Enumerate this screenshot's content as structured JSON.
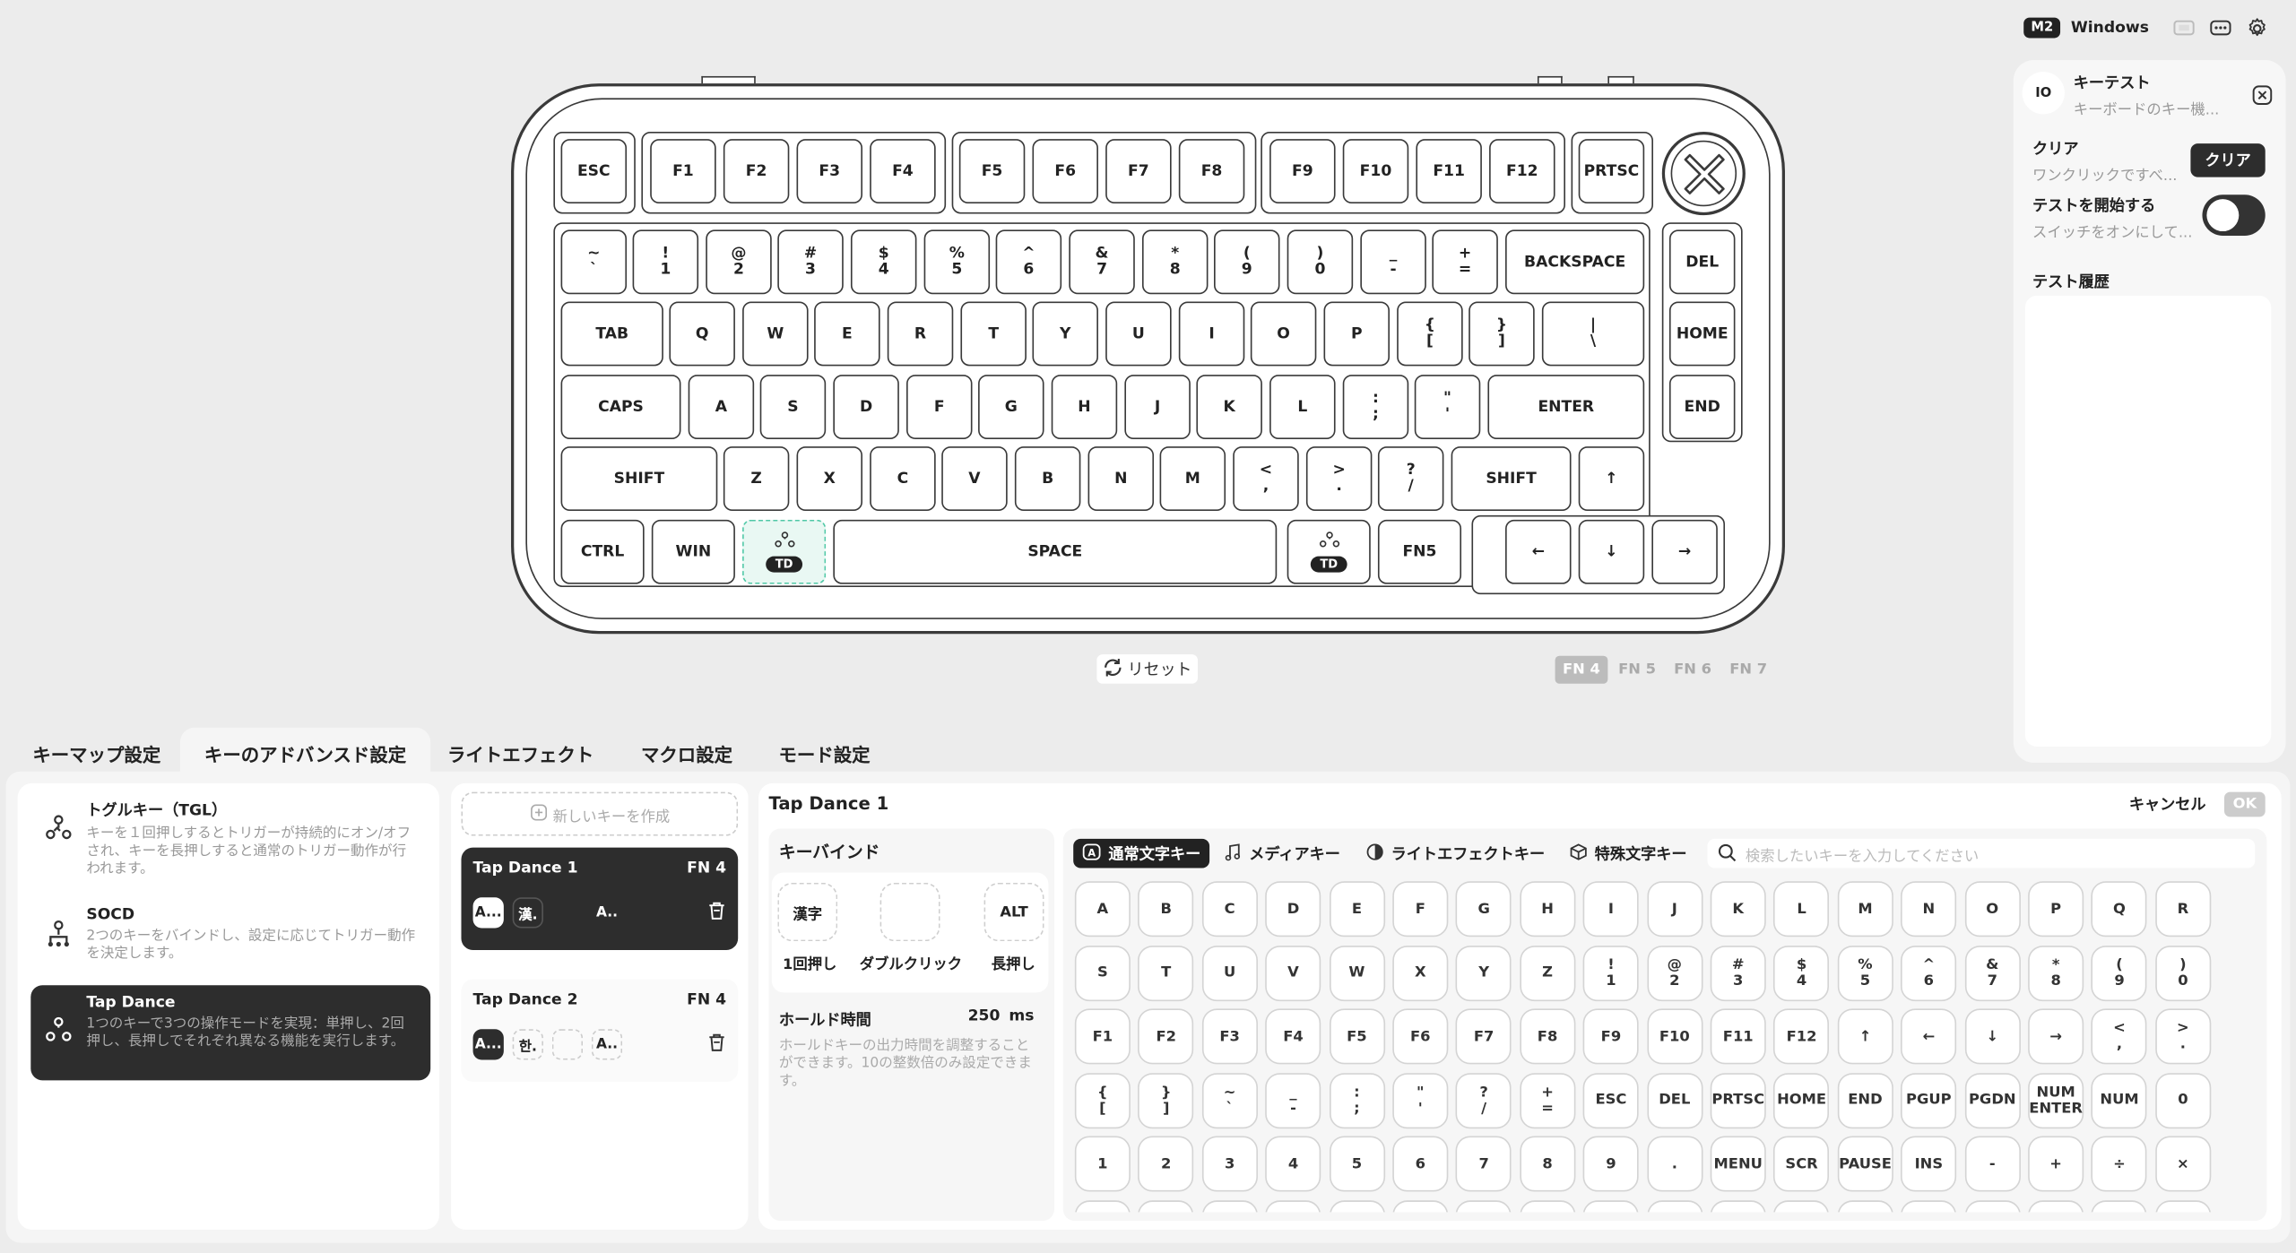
{
  "topbar": {
    "mode_badge": "M2",
    "os": "Windows"
  },
  "keyboard": {
    "rows": [
      [
        {
          "k": "esc",
          "l": [
            "ESC"
          ]
        },
        {
          "k": "f1",
          "l": [
            "F1"
          ]
        },
        {
          "k": "f2",
          "l": [
            "F2"
          ]
        },
        {
          "k": "f3",
          "l": [
            "F3"
          ]
        },
        {
          "k": "f4",
          "l": [
            "F4"
          ]
        },
        {
          "k": "f5",
          "l": [
            "F5"
          ]
        },
        {
          "k": "f6",
          "l": [
            "F6"
          ]
        },
        {
          "k": "f7",
          "l": [
            "F7"
          ]
        },
        {
          "k": "f8",
          "l": [
            "F8"
          ]
        },
        {
          "k": "f9",
          "l": [
            "F9"
          ]
        },
        {
          "k": "f10",
          "l": [
            "F10"
          ]
        },
        {
          "k": "f11",
          "l": [
            "F11"
          ]
        },
        {
          "k": "f12",
          "l": [
            "F12"
          ]
        },
        {
          "k": "prtsc",
          "l": [
            "PRTSC"
          ]
        }
      ],
      [
        {
          "k": "grave",
          "l": [
            "~",
            "`"
          ]
        },
        {
          "k": "1",
          "l": [
            "!",
            "1"
          ]
        },
        {
          "k": "2",
          "l": [
            "@",
            "2"
          ]
        },
        {
          "k": "3",
          "l": [
            "#",
            "3"
          ]
        },
        {
          "k": "4",
          "l": [
            "$",
            "4"
          ]
        },
        {
          "k": "5",
          "l": [
            "%",
            "5"
          ]
        },
        {
          "k": "6",
          "l": [
            "^",
            "6"
          ]
        },
        {
          "k": "7",
          "l": [
            "&",
            "7"
          ]
        },
        {
          "k": "8",
          "l": [
            "*",
            "8"
          ]
        },
        {
          "k": "9",
          "l": [
            "(",
            "9"
          ]
        },
        {
          "k": "0",
          "l": [
            ")",
            "0"
          ]
        },
        {
          "k": "minus",
          "l": [
            "_",
            "-"
          ]
        },
        {
          "k": "equal",
          "l": [
            "+",
            "="
          ]
        },
        {
          "k": "backspace",
          "l": [
            "BACKSPACE"
          ]
        },
        {
          "k": "del",
          "l": [
            "DEL"
          ]
        }
      ],
      [
        {
          "k": "tab",
          "l": [
            "TAB"
          ]
        },
        {
          "k": "q",
          "l": [
            "Q"
          ]
        },
        {
          "k": "w",
          "l": [
            "W"
          ]
        },
        {
          "k": "e",
          "l": [
            "E"
          ]
        },
        {
          "k": "r",
          "l": [
            "R"
          ]
        },
        {
          "k": "t",
          "l": [
            "T"
          ]
        },
        {
          "k": "y",
          "l": [
            "Y"
          ]
        },
        {
          "k": "u",
          "l": [
            "U"
          ]
        },
        {
          "k": "i",
          "l": [
            "I"
          ]
        },
        {
          "k": "o",
          "l": [
            "O"
          ]
        },
        {
          "k": "p",
          "l": [
            "P"
          ]
        },
        {
          "k": "lbracket",
          "l": [
            "{",
            "["
          ]
        },
        {
          "k": "rbracket",
          "l": [
            "}",
            "]"
          ]
        },
        {
          "k": "backslash",
          "l": [
            "|",
            "\\"
          ]
        },
        {
          "k": "home",
          "l": [
            "HOME"
          ]
        }
      ],
      [
        {
          "k": "caps",
          "l": [
            "CAPS"
          ]
        },
        {
          "k": "a",
          "l": [
            "A"
          ]
        },
        {
          "k": "s",
          "l": [
            "S"
          ]
        },
        {
          "k": "d",
          "l": [
            "D"
          ]
        },
        {
          "k": "f",
          "l": [
            "F"
          ]
        },
        {
          "k": "g",
          "l": [
            "G"
          ]
        },
        {
          "k": "h",
          "l": [
            "H"
          ]
        },
        {
          "k": "j",
          "l": [
            "J"
          ]
        },
        {
          "k": "k",
          "l": [
            "K"
          ]
        },
        {
          "k": "l",
          "l": [
            "L"
          ]
        },
        {
          "k": "semicolon",
          "l": [
            ":",
            ";"
          ]
        },
        {
          "k": "quote",
          "l": [
            "\"",
            "'"
          ]
        },
        {
          "k": "enter",
          "l": [
            "ENTER"
          ]
        },
        {
          "k": "end",
          "l": [
            "END"
          ]
        }
      ],
      [
        {
          "k": "lshift",
          "l": [
            "SHIFT"
          ]
        },
        {
          "k": "z",
          "l": [
            "Z"
          ]
        },
        {
          "k": "x",
          "l": [
            "X"
          ]
        },
        {
          "k": "c",
          "l": [
            "C"
          ]
        },
        {
          "k": "v",
          "l": [
            "V"
          ]
        },
        {
          "k": "b",
          "l": [
            "B"
          ]
        },
        {
          "k": "n",
          "l": [
            "N"
          ]
        },
        {
          "k": "m",
          "l": [
            "M"
          ]
        },
        {
          "k": "comma",
          "l": [
            "<",
            ","
          ]
        },
        {
          "k": "period",
          "l": [
            ">",
            "."
          ]
        },
        {
          "k": "slash",
          "l": [
            "?",
            "/"
          ]
        },
        {
          "k": "rshift",
          "l": [
            "SHIFT"
          ]
        },
        {
          "k": "up",
          "l": [
            "↑"
          ]
        }
      ],
      [
        {
          "k": "ctrl",
          "l": [
            "CTRL"
          ]
        },
        {
          "k": "win",
          "l": [
            "WIN"
          ]
        },
        {
          "k": "td-left",
          "l": [],
          "td": "TD",
          "selected": true
        },
        {
          "k": "space",
          "l": [
            "SPACE"
          ]
        },
        {
          "k": "td-right",
          "l": [],
          "td": "TD"
        },
        {
          "k": "fn5",
          "l": [
            "FN5"
          ]
        },
        {
          "k": "left",
          "l": [
            "←"
          ]
        },
        {
          "k": "down",
          "l": [
            "↓"
          ]
        },
        {
          "k": "right",
          "l": [
            "→"
          ]
        }
      ]
    ],
    "reset_label": "リセット",
    "layers": [
      "FN 4",
      "FN 5",
      "FN 6",
      "FN 7"
    ]
  },
  "key_test": {
    "icon_label": "IO",
    "title": "キーテスト",
    "subtitle": "キーボードのキー機...",
    "clear_title": "クリア",
    "clear_desc": "ワンクリックですべ...",
    "clear_button": "クリア",
    "start_title": "テストを開始する",
    "start_desc": "スイッチをオンにして...",
    "start_on": false,
    "history_title": "テスト履歴"
  },
  "tabs": [
    "キーマップ設定",
    "キーのアドバンスド設定",
    "ライトエフェクト",
    "マクロ設定",
    "モード設定"
  ],
  "modes": [
    {
      "title": "トグルキー（TGL）",
      "desc": "キーを１回押しするとトリガーが持続的にオン/オフされ、キーを長押しすると通常のトリガー動作が行われます。"
    },
    {
      "title": "SOCD",
      "desc": "2つのキーをバインドし、設定に応じてトリガー動作を決定します。"
    },
    {
      "title": "Tap Dance",
      "desc": "1つのキーで3つの操作モードを実現：単押し、2回押し、長押しでそれぞれ異なる機能を実行します。"
    }
  ],
  "new_key_label": "新しいキーを作成",
  "td_list": [
    {
      "name": "Tap Dance  1",
      "layer": "FN 4",
      "slots": [
        "A...",
        "漢.",
        "",
        "A.."
      ]
    },
    {
      "name": "Tap Dance  2",
      "layer": "FN 4",
      "slots": [
        "A...",
        "한.",
        "",
        "A.."
      ]
    }
  ],
  "editor": {
    "title": "Tap Dance 1",
    "cancel": "キャンセル",
    "ok": "OK",
    "keybind_title": "キーバインド",
    "bind_slots": [
      "漢字",
      "",
      "ALT"
    ],
    "bind_labels": [
      "1回押し",
      "ダブルクリック",
      "長押し"
    ],
    "hold_title": "ホールド時間",
    "hold_value": "250",
    "hold_unit": "ms",
    "hold_desc": "ホールドキーの出力時間を調整することができます。10の整数倍のみ設定できます。"
  },
  "picker": {
    "categories": [
      "通常文字キー",
      "メディアキー",
      "ライトエフェクトキー",
      "特殊文字キー"
    ],
    "search_placeholder": "検索したいキーを入力してください",
    "rows": [
      [
        [
          "A"
        ],
        [
          "B"
        ],
        [
          "C"
        ],
        [
          "D"
        ],
        [
          "E"
        ],
        [
          "F"
        ],
        [
          "G"
        ],
        [
          "H"
        ],
        [
          "I"
        ],
        [
          "J"
        ],
        [
          "K"
        ],
        [
          "L"
        ],
        [
          "M"
        ],
        [
          "N"
        ],
        [
          "O"
        ],
        [
          "P"
        ],
        [
          "Q"
        ],
        [
          "R"
        ]
      ],
      [
        [
          "S"
        ],
        [
          "T"
        ],
        [
          "U"
        ],
        [
          "V"
        ],
        [
          "W"
        ],
        [
          "X"
        ],
        [
          "Y"
        ],
        [
          "Z"
        ],
        [
          "!",
          "1"
        ],
        [
          "@",
          "2"
        ],
        [
          "#",
          "3"
        ],
        [
          "$",
          "4"
        ],
        [
          "%",
          "5"
        ],
        [
          "^",
          "6"
        ],
        [
          "&",
          "7"
        ],
        [
          "*",
          "8"
        ],
        [
          "(",
          "9"
        ],
        [
          ")",
          "0"
        ]
      ],
      [
        [
          "F1"
        ],
        [
          "F2"
        ],
        [
          "F3"
        ],
        [
          "F4"
        ],
        [
          "F5"
        ],
        [
          "F6"
        ],
        [
          "F7"
        ],
        [
          "F8"
        ],
        [
          "F9"
        ],
        [
          "F10"
        ],
        [
          "F11"
        ],
        [
          "F12"
        ],
        [
          "↑"
        ],
        [
          "←"
        ],
        [
          "↓"
        ],
        [
          "→"
        ],
        [
          "<",
          ","
        ],
        [
          ">",
          "."
        ]
      ],
      [
        [
          "{",
          "["
        ],
        [
          "}",
          "]"
        ],
        [
          "~",
          "`"
        ],
        [
          "_",
          "-"
        ],
        [
          ":",
          ";"
        ],
        [
          "\"",
          "'"
        ],
        [
          "?",
          "/"
        ],
        [
          "+",
          "="
        ],
        [
          "ESC"
        ],
        [
          "DEL"
        ],
        [
          "PRTSC"
        ],
        [
          "HOME"
        ],
        [
          "END"
        ],
        [
          "PGUP"
        ],
        [
          "PGDN"
        ],
        [
          "NUM",
          "ENTER"
        ],
        [
          "NUM"
        ],
        [
          "0"
        ]
      ],
      [
        [
          "1"
        ],
        [
          "2"
        ],
        [
          "3"
        ],
        [
          "4"
        ],
        [
          "5"
        ],
        [
          "6"
        ],
        [
          "7"
        ],
        [
          "8"
        ],
        [
          "9"
        ],
        [
          "."
        ],
        [
          "MENU"
        ],
        [
          "SCR"
        ],
        [
          "PAUSE"
        ],
        [
          "INS"
        ],
        [
          "-"
        ],
        [
          "+"
        ],
        [
          "÷"
        ],
        [
          "×"
        ]
      ]
    ]
  }
}
